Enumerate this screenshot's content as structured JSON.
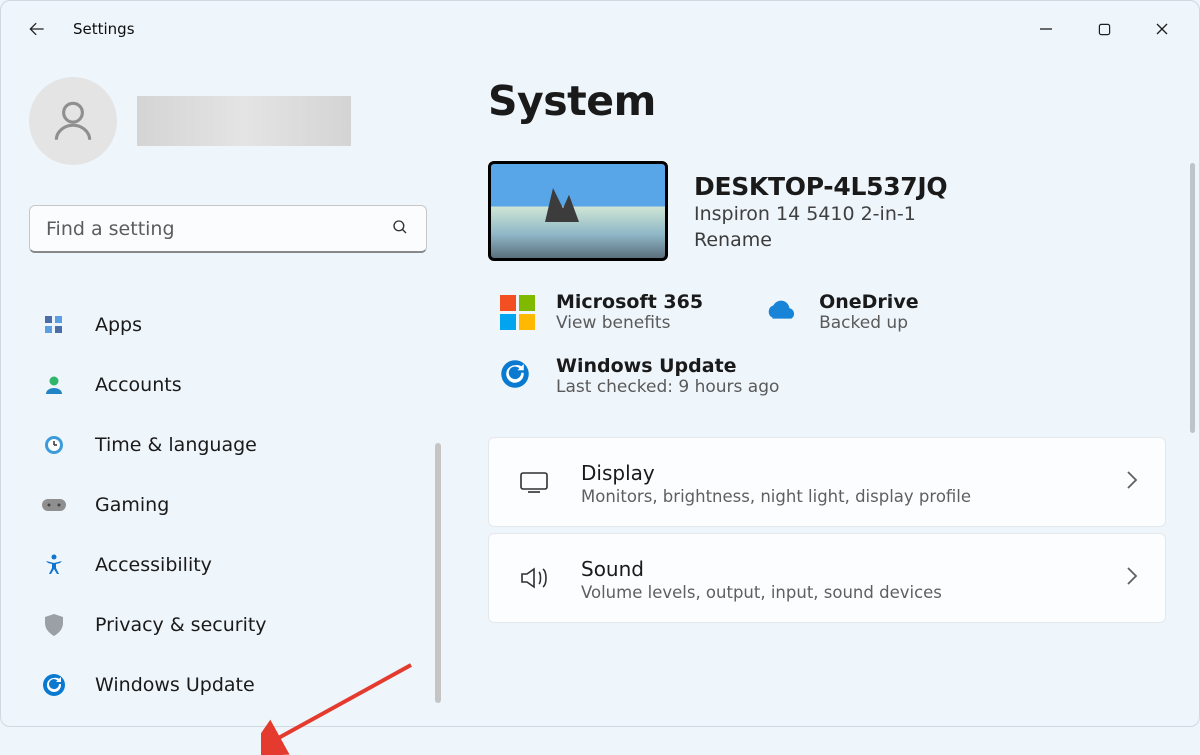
{
  "titlebar": {
    "app_title": "Settings"
  },
  "search": {
    "placeholder": "Find a setting"
  },
  "nav": {
    "items": [
      {
        "label": "Apps"
      },
      {
        "label": "Accounts"
      },
      {
        "label": "Time & language"
      },
      {
        "label": "Gaming"
      },
      {
        "label": "Accessibility"
      },
      {
        "label": "Privacy & security"
      },
      {
        "label": "Windows Update"
      }
    ]
  },
  "main": {
    "title": "System",
    "device": {
      "name": "DESKTOP-4L537JQ",
      "model": "Inspiron 14 5410 2-in-1",
      "rename": "Rename"
    },
    "cloud": {
      "m365_title": "Microsoft 365",
      "m365_sub": "View benefits",
      "onedrive_title": "OneDrive",
      "onedrive_sub": "Backed up"
    },
    "update": {
      "title": "Windows Update",
      "sub": "Last checked: 9 hours ago"
    },
    "settings": [
      {
        "title": "Display",
        "sub": "Monitors, brightness, night light, display profile"
      },
      {
        "title": "Sound",
        "sub": "Volume levels, output, input, sound devices"
      }
    ]
  }
}
